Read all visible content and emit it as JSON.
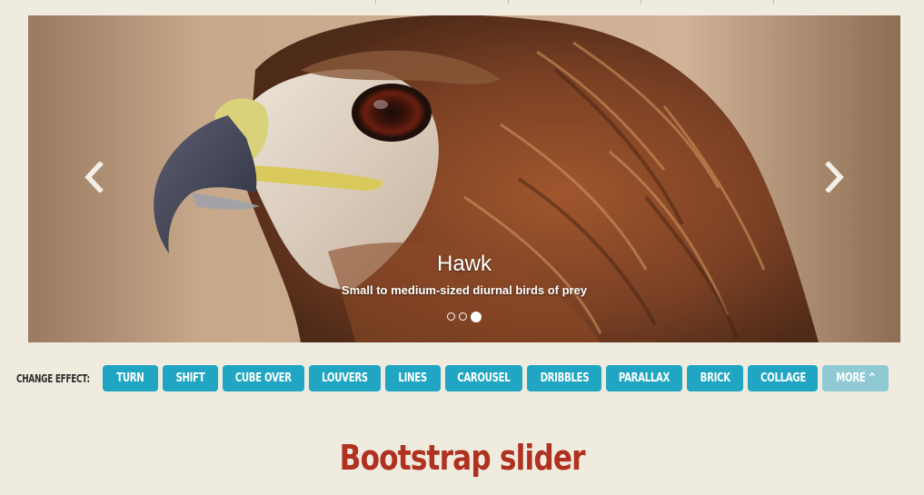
{
  "top_nav": {
    "dividers": 4
  },
  "slider": {
    "slide": {
      "image": "hawk-photo",
      "title": "Hawk",
      "description": "Small to medium-sized diurnal birds of prey"
    },
    "prev_icon": "chevron-left-icon",
    "next_icon": "chevron-right-icon",
    "pagination": {
      "total": 3,
      "active_index": 2
    }
  },
  "effects": {
    "label": "CHANGE EFFECT:",
    "buttons": [
      {
        "label": "TURN"
      },
      {
        "label": "SHIFT"
      },
      {
        "label": "CUBE OVER"
      },
      {
        "label": "LOUVERS"
      },
      {
        "label": "LINES"
      },
      {
        "label": "CAROUSEL"
      },
      {
        "label": "DRIBBLES"
      },
      {
        "label": "PARALLAX"
      },
      {
        "label": "BRICK"
      },
      {
        "label": "COLLAGE"
      },
      {
        "label": "MORE ^"
      }
    ]
  },
  "heading": "Bootstrap slider",
  "colors": {
    "page_bg": "#efebdf",
    "button": "#20a6c3",
    "button_more": "#8fcad3",
    "heading": "#b0311f"
  }
}
